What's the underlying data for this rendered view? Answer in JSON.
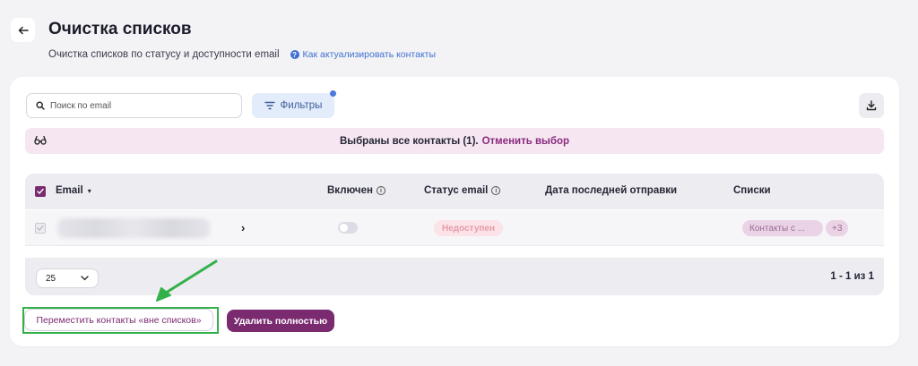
{
  "header": {
    "title": "Очистка списков",
    "subtitle": "Очистка списков по статусу и доступности email",
    "help_link": "Как актуализировать контакты",
    "back_icon": "arrow-left-icon"
  },
  "toolbar": {
    "search_placeholder": "Поиск по email",
    "filters_label": "Фильтры",
    "filters_badge_color": "#4a79dd",
    "download_icon": "download-icon"
  },
  "selection_banner": {
    "text": "Выбраны все контакты (1).",
    "cancel_label": "Отменить выбор",
    "icon": "glasses-icon",
    "background": "#f5e6f1"
  },
  "table": {
    "columns": [
      "Email",
      "Включен",
      "Статус email",
      "Дата последней отправки",
      "Списки"
    ],
    "header_checked": true,
    "rows": [
      {
        "email": "",
        "enabled": false,
        "status": "Недоступен",
        "last_sent": "",
        "list": "Контакты с ...",
        "more_lists": "+3"
      }
    ]
  },
  "pagination": {
    "per_page": "25",
    "range": "1 - 1 из 1"
  },
  "actions": {
    "move_label": "Переместить контакты «вне списков»",
    "delete_label": "Удалить полностью",
    "accent": "#7a2a6f",
    "highlight": "#32b04a"
  }
}
